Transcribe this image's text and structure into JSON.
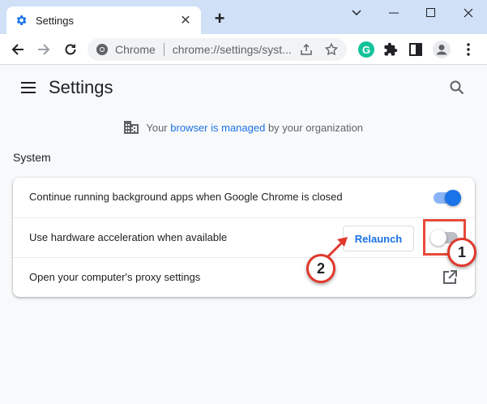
{
  "window": {
    "tab_title": "Settings",
    "tab_close_icon": "close-icon",
    "new_tab_label": "+"
  },
  "toolbar": {
    "omnibox_chip": "Chrome",
    "url": "chrome://settings/syst..."
  },
  "extensions": {
    "grammarly_letter": "G"
  },
  "header": {
    "title": "Settings"
  },
  "managed": {
    "prefix": "Your",
    "link": "browser is managed",
    "suffix": "by your organization"
  },
  "section": {
    "title": "System"
  },
  "settings": {
    "rows": [
      {
        "label": "Continue running background apps when Google Chrome is closed",
        "toggle_on": true
      },
      {
        "label": "Use hardware acceleration when available",
        "toggle_on": false,
        "button_label": "Relaunch"
      },
      {
        "label": "Open your computer's proxy settings"
      }
    ]
  },
  "annotations": {
    "callout_1": "1",
    "callout_2": "2",
    "accent": "#e0392c"
  },
  "colors": {
    "tabstrip": "#cfe0f7",
    "accent_blue": "#1a73e8"
  }
}
